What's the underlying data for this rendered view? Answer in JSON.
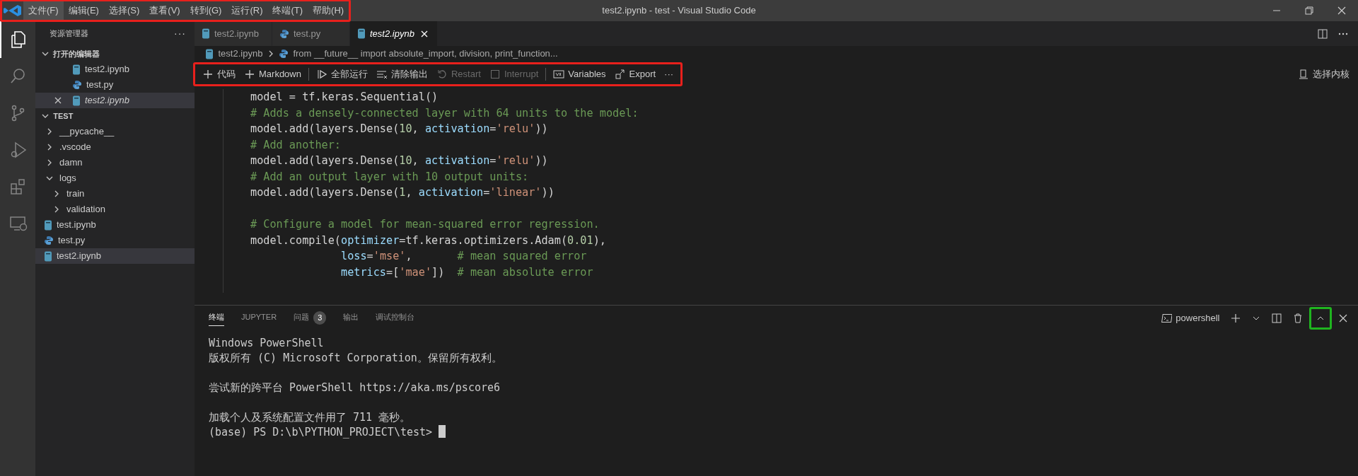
{
  "title_bar": {
    "title": "test2.ipynb - test - Visual Studio Code",
    "highlighted": true,
    "menus": [
      {
        "label": "文件(F)",
        "selected": true
      },
      {
        "label": "编辑(E)",
        "selected": false
      },
      {
        "label": "选择(S)",
        "selected": false
      },
      {
        "label": "查看(V)",
        "selected": false
      },
      {
        "label": "转到(G)",
        "selected": false
      },
      {
        "label": "运行(R)",
        "selected": false
      },
      {
        "label": "终端(T)",
        "selected": false
      },
      {
        "label": "帮助(H)",
        "selected": false
      }
    ]
  },
  "activity_bar": [
    {
      "kind": "files",
      "selected": true
    },
    {
      "kind": "search",
      "selected": false
    },
    {
      "kind": "source-control",
      "selected": false
    },
    {
      "kind": "run-debug",
      "selected": false
    },
    {
      "kind": "extensions",
      "selected": false
    },
    {
      "kind": "remote",
      "selected": false
    }
  ],
  "sidebar": {
    "title": "资源管理器",
    "more": "···",
    "open_editors": {
      "title": "打开的编辑器",
      "expanded": true,
      "items": [
        {
          "label": "test2.ipynb",
          "kind": "notebook",
          "selected": false,
          "preview": false
        },
        {
          "label": "test.py",
          "kind": "python",
          "selected": false,
          "preview": false
        },
        {
          "label": "test2.ipynb",
          "kind": "notebook",
          "selected": true,
          "preview": true
        }
      ]
    },
    "folder": {
      "title": "TEST",
      "expanded": true,
      "items": [
        {
          "label": "__pycache__",
          "kind": "folder",
          "expanded": false,
          "selected": false
        },
        {
          "label": ".vscode",
          "kind": "folder",
          "expanded": false,
          "selected": false
        },
        {
          "label": "damn",
          "kind": "folder",
          "expanded": false,
          "selected": false
        },
        {
          "label": "logs",
          "kind": "folder",
          "expanded": true,
          "selected": false,
          "children": [
            {
              "label": "train",
              "kind": "folder",
              "expanded": false,
              "selected": false
            },
            {
              "label": "validation",
              "kind": "folder",
              "expanded": false,
              "selected": false
            }
          ]
        },
        {
          "label": "test.ipynb",
          "kind": "notebook",
          "selected": false
        },
        {
          "label": "test.py",
          "kind": "python",
          "selected": false
        },
        {
          "label": "test2.ipynb",
          "kind": "notebook",
          "selected": true
        }
      ]
    }
  },
  "tabs": [
    {
      "label": "test2.ipynb",
      "kind": "notebook",
      "selected": false,
      "preview": false
    },
    {
      "label": "test.py",
      "kind": "python",
      "selected": false,
      "preview": false
    },
    {
      "label": "test2.ipynb",
      "kind": "notebook",
      "selected": true,
      "preview": true
    }
  ],
  "breadcrumb": [
    {
      "label": "test2.ipynb",
      "kind": "notebook"
    },
    {
      "label": "from __future__ import absolute_import, division, print_function...",
      "kind": "python"
    }
  ],
  "toolbar": {
    "highlighted": true,
    "items": [
      {
        "kind": "add",
        "label": "代码",
        "disabled": false
      },
      {
        "kind": "add",
        "label": "Markdown",
        "disabled": false
      },
      {
        "kind": "separator"
      },
      {
        "kind": "run-all",
        "label": "全部运行",
        "disabled": false
      },
      {
        "kind": "clear",
        "label": "清除输出",
        "disabled": false
      },
      {
        "kind": "restart",
        "label": "Restart",
        "disabled": true
      },
      {
        "kind": "interrupt",
        "label": "Interrupt",
        "disabled": true
      },
      {
        "kind": "separator"
      },
      {
        "kind": "variables",
        "label": "Variables",
        "disabled": false
      },
      {
        "kind": "export",
        "label": "Export",
        "disabled": false
      },
      {
        "kind": "more",
        "label": "···",
        "disabled": false
      }
    ],
    "kernel": "选择内核"
  },
  "code": [
    {
      "tokens": [
        {
          "t": "model = tf.keras.Sequential()",
          "kind": "plain"
        }
      ]
    },
    {
      "tokens": [
        {
          "t": "# Adds a densely-connected layer with 64 units to the model:",
          "kind": "comment"
        }
      ]
    },
    {
      "tokens": [
        {
          "t": "model.add(layers.Dense(",
          "kind": "plain"
        },
        {
          "t": "10",
          "kind": "number"
        },
        {
          "t": ", ",
          "kind": "plain"
        },
        {
          "t": "activation",
          "kind": "param"
        },
        {
          "t": "=",
          "kind": "plain"
        },
        {
          "t": "'relu'",
          "kind": "string"
        },
        {
          "t": "))",
          "kind": "plain"
        }
      ]
    },
    {
      "tokens": [
        {
          "t": "# Add another:",
          "kind": "comment"
        }
      ]
    },
    {
      "tokens": [
        {
          "t": "model.add(layers.Dense(",
          "kind": "plain"
        },
        {
          "t": "10",
          "kind": "number"
        },
        {
          "t": ", ",
          "kind": "plain"
        },
        {
          "t": "activation",
          "kind": "param"
        },
        {
          "t": "=",
          "kind": "plain"
        },
        {
          "t": "'relu'",
          "kind": "string"
        },
        {
          "t": "))",
          "kind": "plain"
        }
      ]
    },
    {
      "tokens": [
        {
          "t": "# Add an output layer with 10 output units:",
          "kind": "comment"
        }
      ]
    },
    {
      "tokens": [
        {
          "t": "model.add(layers.Dense(",
          "kind": "plain"
        },
        {
          "t": "1",
          "kind": "number"
        },
        {
          "t": ", ",
          "kind": "plain"
        },
        {
          "t": "activation",
          "kind": "param"
        },
        {
          "t": "=",
          "kind": "plain"
        },
        {
          "t": "'linear'",
          "kind": "string"
        },
        {
          "t": "))",
          "kind": "plain"
        }
      ]
    },
    {
      "gap_before": true,
      "tokens": [
        {
          "t": "# Configure a model for mean-squared error regression.",
          "kind": "comment"
        }
      ]
    },
    {
      "tokens": [
        {
          "t": "model.compile(",
          "kind": "plain"
        },
        {
          "t": "optimizer",
          "kind": "param"
        },
        {
          "t": "=tf.keras.optimizers.Adam(",
          "kind": "plain"
        },
        {
          "t": "0.01",
          "kind": "number"
        },
        {
          "t": "),",
          "kind": "plain"
        }
      ]
    },
    {
      "continuation": true,
      "tokens": [
        {
          "t": "loss",
          "kind": "param"
        },
        {
          "t": "=",
          "kind": "plain"
        },
        {
          "t": "'mse'",
          "kind": "string"
        },
        {
          "t": ",       ",
          "kind": "plain"
        },
        {
          "t": "# mean squared error",
          "kind": "comment"
        }
      ]
    },
    {
      "continuation": true,
      "tokens": [
        {
          "t": "metrics",
          "kind": "param"
        },
        {
          "t": "=[",
          "kind": "plain"
        },
        {
          "t": "'mae'",
          "kind": "string"
        },
        {
          "t": "])  ",
          "kind": "plain"
        },
        {
          "t": "# mean absolute error",
          "kind": "comment"
        }
      ]
    }
  ],
  "panel": {
    "tabs": [
      {
        "label": "终端",
        "selected": true
      },
      {
        "label": "JUPYTER",
        "selected": false
      },
      {
        "label": "问题",
        "selected": false,
        "badge": "3"
      },
      {
        "label": "输出",
        "selected": false
      },
      {
        "label": "调试控制台",
        "selected": false
      }
    ],
    "shell": "powershell",
    "actions": [
      {
        "kind": "add",
        "highlighted": false
      },
      {
        "kind": "dropdown",
        "highlighted": false
      },
      {
        "kind": "split",
        "highlighted": false
      },
      {
        "kind": "trash",
        "highlighted": false
      },
      {
        "kind": "maximize",
        "highlighted": true
      },
      {
        "kind": "close",
        "highlighted": false
      }
    ],
    "terminal": [
      {
        "text": "Windows PowerShell"
      },
      {
        "text": "版权所有 (C) Microsoft Corporation。保留所有权利。"
      },
      {
        "text": "尝试新的跨平台 PowerShell https://aka.ms/pscore6",
        "gap_before": true
      },
      {
        "text": "加载个人及系统配置文件用了 711 毫秒。",
        "gap_before": true
      },
      {
        "text": "(base) PS D:\\b\\PYTHON_PROJECT\\test> "
      }
    ],
    "cursor": true
  }
}
